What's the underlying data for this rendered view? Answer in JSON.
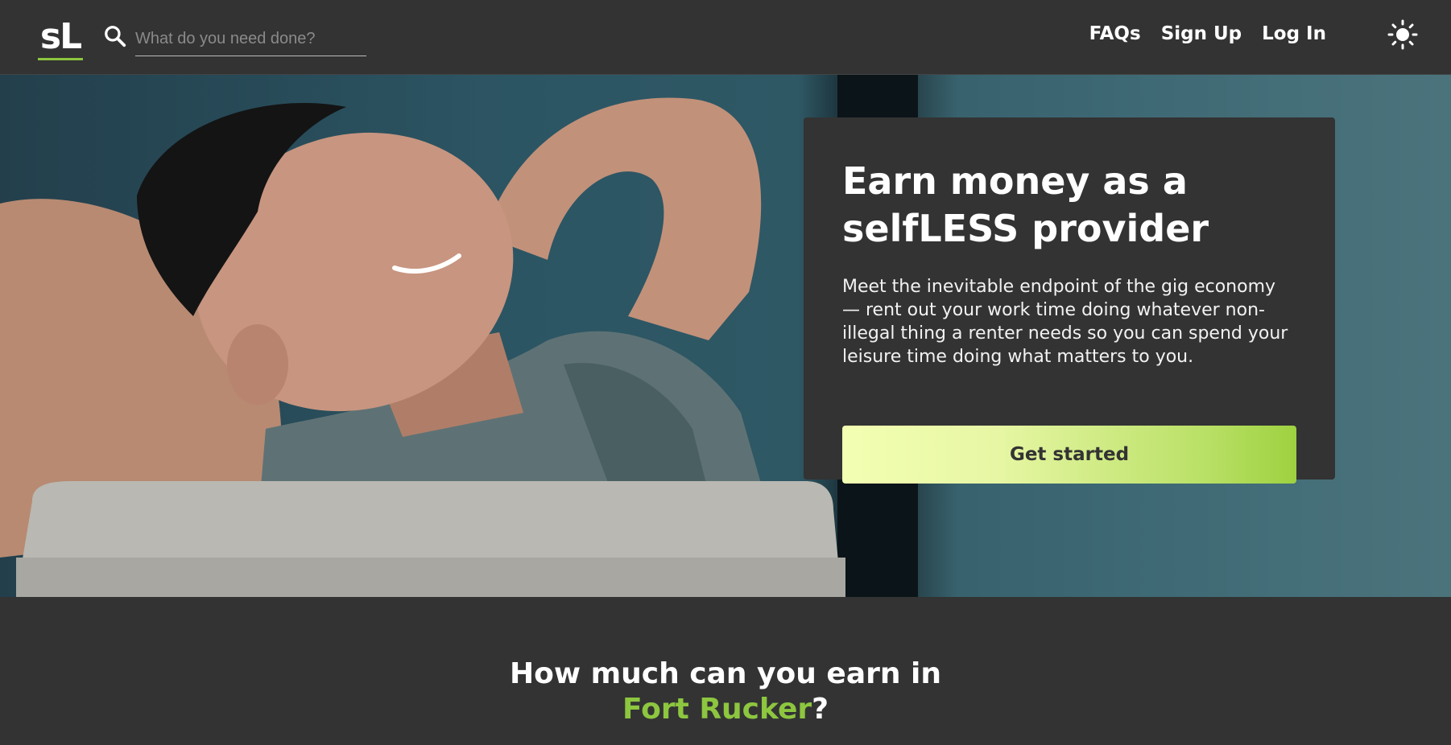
{
  "header": {
    "logo_text": "sL",
    "search_placeholder": "What do you need done?",
    "nav": {
      "faqs": "FAQs",
      "sign_up": "Sign Up",
      "log_in": "Log In"
    },
    "theme_icon": "sun-icon"
  },
  "hero": {
    "title_line1": "Earn money as a",
    "title_line2": "selfLESS provider",
    "description": "Meet the inevitable endpoint of the gig economy — rent out your work time doing whatever non-illegal thing a renter needs so you can spend your leisure time doing what matters to you.",
    "cta_label": "Get started"
  },
  "earnings": {
    "heading_line1": "How much can you earn in",
    "city": "Fort Rucker",
    "question_mark": "?"
  },
  "colors": {
    "background": "#333333",
    "accent_green": "#8dc63f",
    "cta_gradient_start": "#f3ffb3",
    "cta_gradient_end": "#9ed140"
  }
}
